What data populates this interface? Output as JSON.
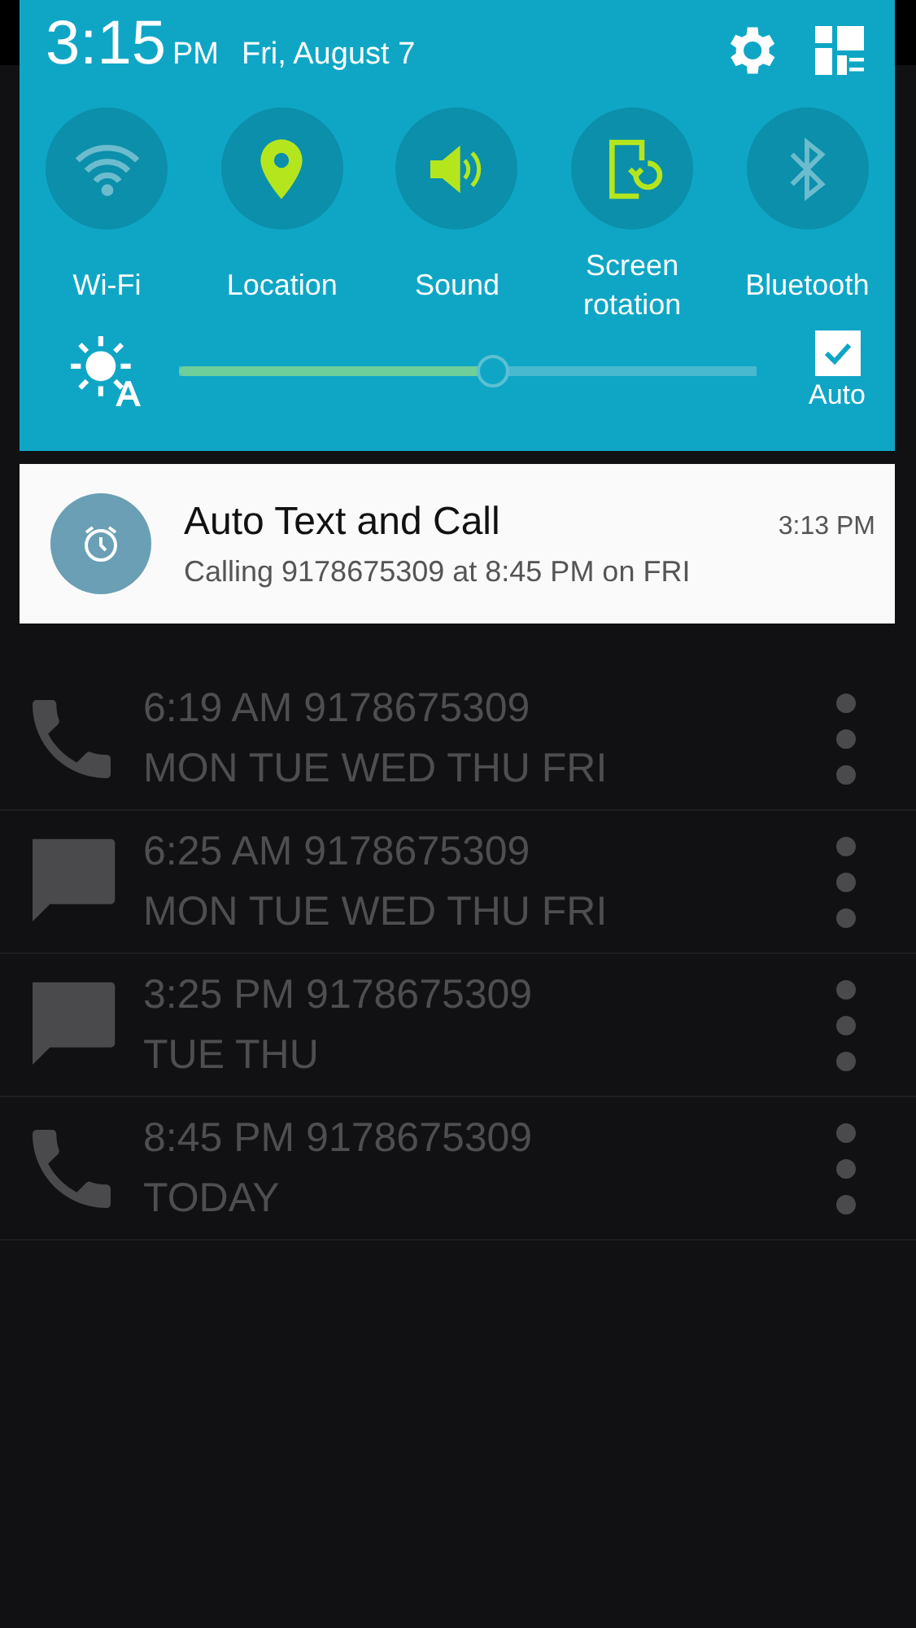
{
  "panel": {
    "time": "3:15",
    "ampm": "PM",
    "date": "Fri, August 7",
    "toggles": [
      {
        "kind": "wifi",
        "label": "Wi-Fi",
        "on": false
      },
      {
        "kind": "location",
        "label": "Location",
        "on": true
      },
      {
        "kind": "sound",
        "label": "Sound",
        "on": true
      },
      {
        "kind": "rotation",
        "label": "Screen rotation",
        "on": true
      },
      {
        "kind": "bluetooth",
        "label": "Bluetooth",
        "on": false
      }
    ],
    "brightness": {
      "level": 0.54,
      "auto_label": "Auto",
      "auto_checked": true
    }
  },
  "notification": {
    "title": "Auto Text and Call",
    "time": "3:13 PM",
    "text": "Calling 9178675309 at 8:45 PM on FRI"
  },
  "schedules": [
    {
      "kind": "call",
      "time": "6:19 AM 9178675309",
      "days": "MON TUE WED THU FRI"
    },
    {
      "kind": "text",
      "time": "6:25 AM 9178675309",
      "days": "MON TUE WED THU FRI"
    },
    {
      "kind": "text",
      "time": "3:25 PM 9178675309",
      "days": "TUE THU"
    },
    {
      "kind": "call",
      "time": "8:45 PM 9178675309",
      "days": "TODAY"
    }
  ]
}
